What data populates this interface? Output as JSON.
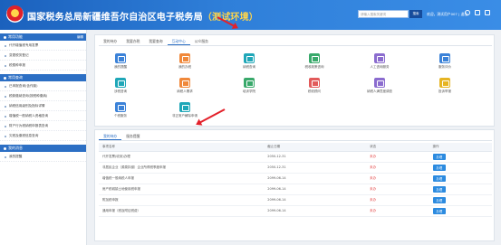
{
  "header": {
    "title": "国家税务总局新疆维吾尔自治区电子税务局",
    "env_tag": "（测试环境）",
    "search_placeholder": "请输入搜索关键词",
    "search_button": "搜索",
    "user_text": "欢迎，测试用户007 | 退出"
  },
  "sidebar": {
    "sections": [
      {
        "title": "常用功能",
        "extra": "编辑",
        "items": [
          "代开增值税专用发票",
          "变更税务登记",
          "税费种申报"
        ]
      },
      {
        "title": "常用查询",
        "extra": "",
        "items": [
          "已申报查询(含作废)",
          "税款缴纳查询(按税种缴纳)",
          "纳税信用级别及指标详情",
          "增值税一般纳税人资格查询",
          "财产行为税纳税申报表查询",
          "欠税及缴税信息查询"
        ]
      },
      {
        "title": "我的消息",
        "extra": "",
        "items": [
          "我的提醒"
        ]
      }
    ]
  },
  "main": {
    "tabs": [
      "我的待办",
      "我要办税",
      "我要查询",
      "互动中心",
      "公众服务"
    ],
    "active_tab": 3,
    "functions": [
      {
        "label": "我的提醒",
        "color": "blue"
      },
      {
        "label": "我的办税",
        "color": "orange"
      },
      {
        "label": "纳税查询",
        "color": "teal"
      },
      {
        "label": "税收政策咨询",
        "color": "green"
      },
      {
        "label": "人工咨询服务",
        "color": "purple"
      },
      {
        "label": "服务评价",
        "color": "blue"
      },
      {
        "label": "涉税咨询",
        "color": "teal"
      },
      {
        "label": "纳税人需求",
        "color": "orange"
      },
      {
        "label": "培训学院",
        "color": "green"
      },
      {
        "label": "税收顾问",
        "color": "red"
      },
      {
        "label": "纳税人满意度调查",
        "color": "purple"
      },
      {
        "label": "投诉举报",
        "color": "yellow"
      },
      {
        "label": "个税服务",
        "color": "blue"
      },
      {
        "label": "非正常户解除申请",
        "color": "teal"
      }
    ]
  },
  "todo": {
    "tabs": [
      "我的待办",
      "服务提醒"
    ],
    "columns": [
      "事项名称",
      "截止日期",
      "状态",
      "操作"
    ],
    "rows": [
      {
        "name": "代开发票(收到)办理",
        "date": "2050-12-31",
        "status": "未办",
        "action": "办理"
      },
      {
        "name": "非居民企业（源泉扣缴）企业所得税季度申报",
        "date": "2050-12-31",
        "status": "未办",
        "action": "办理"
      },
      {
        "name": "增值税一般纳税人申报",
        "date": "2099-06-14",
        "status": "未办",
        "action": "办理"
      },
      {
        "name": "房产税城镇土地使用税申报",
        "date": "2099-06-14",
        "status": "未办",
        "action": "办理"
      },
      {
        "name": "附加税申报",
        "date": "2099-06-14",
        "status": "未办",
        "action": "办理"
      },
      {
        "name": "通用申报（税及附征税费）",
        "date": "2099-06-14",
        "status": "未办",
        "action": "办理"
      }
    ]
  }
}
